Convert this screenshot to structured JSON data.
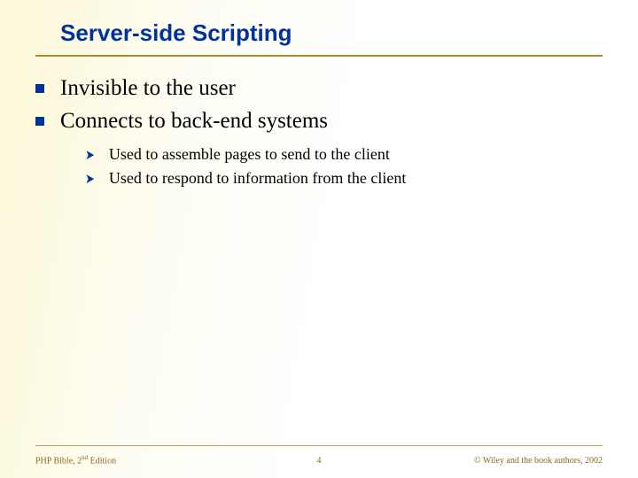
{
  "title": "Server-side Scripting",
  "bullets": {
    "b0": "Invisible to the user",
    "b1": "Connects to back-end systems",
    "sub0": "Used to assemble pages to send to the client",
    "sub1": "Used to respond to information from the client"
  },
  "footer": {
    "left_prefix": "PHP Bible, 2",
    "left_sup": "nd",
    "left_suffix": " Edition",
    "page": "4",
    "right": "© Wiley and the book authors, 2002"
  }
}
